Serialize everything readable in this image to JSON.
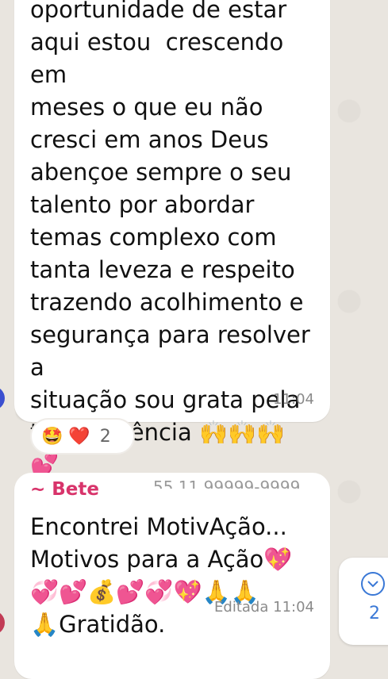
{
  "message1": {
    "text": "oportunidade de estar\naqui estou  crescendo em\nmeses o que eu não\ncresci em anos Deus\nabençoe sempre o seu\ntalento por abordar\ntemas complexo com\ntanta leveza e respeito\ntrazendo acolhimento e\nsegurança para resolver a\nsituação sou grata pela\ntua existência 🙌🙌🙌\n💕",
    "time": "11:04",
    "reactions": {
      "emojis": "🤩 ❤️",
      "count": "2"
    }
  },
  "message2": {
    "sender": "~ Bete",
    "phone": "55 11 99999-9999",
    "text": "Encontrei MotivAção...\nMotivos para a Ação💖\n💞💕💰💕💞💖🙏🙏\n🙏Gratidão.",
    "edited_time": "Editada 11:04"
  },
  "scroll_button": {
    "icon": "chevron-down-icon",
    "unread_count": "2"
  },
  "colors": {
    "wallpaper": "#e9e5df",
    "bubble": "#ffffff",
    "sender": "#d8346b",
    "accent": "#3a78d6"
  }
}
